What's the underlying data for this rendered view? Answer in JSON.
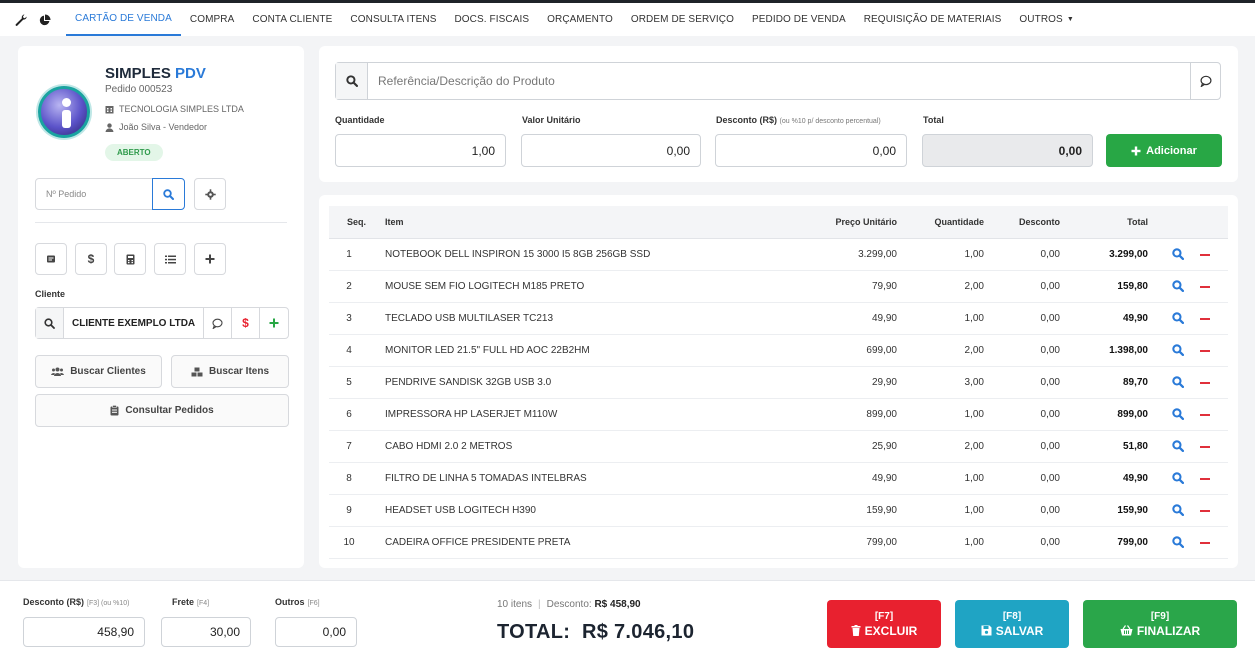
{
  "nav": {
    "items": [
      "CARTÃO DE VENDA",
      "COMPRA",
      "CONTA CLIENTE",
      "CONSULTA ITENS",
      "DOCS. FISCAIS",
      "ORÇAMENTO",
      "ORDEM DE SERVIÇO",
      "PEDIDO DE VENDA",
      "REQUISIÇÃO DE MATERIAIS",
      "OUTROS"
    ],
    "active_index": 0
  },
  "sidebar": {
    "brand_main": "SIMPLES",
    "brand_accent": "PDV",
    "pedido": "Pedido 000523",
    "company": "TECNOLOGIA SIMPLES LTDA",
    "vendor": "João Silva - Vendedor",
    "status": "ABERTO",
    "pedido_placeholder": "Nº Pedido",
    "cliente_label": "Cliente",
    "cliente_name": "CLIENTE EXEMPLO LTDA",
    "buscar_clientes": "Buscar Clientes",
    "buscar_itens": "Buscar Itens",
    "consultar_pedidos": "Consultar Pedidos"
  },
  "product_form": {
    "search_placeholder": "Referência/Descrição do Produto",
    "quantidade_label": "Quantidade",
    "quantidade": "1,00",
    "valor_label": "Valor Unitário",
    "valor": "0,00",
    "desconto_label": "Desconto (R$)",
    "desconto_hint": "(ou %10 p/ desconto percentual)",
    "desconto": "0,00",
    "total_label": "Total",
    "total": "0,00",
    "add_label": "Adicionar"
  },
  "table": {
    "headers": {
      "seq": "Seq.",
      "item": "Item",
      "preco": "Preço Unitário",
      "qtd": "Quantidade",
      "desc": "Desconto",
      "total": "Total"
    },
    "rows": [
      {
        "seq": "1",
        "item": "NOTEBOOK DELL INSPIRON 15 3000 I5 8GB 256GB SSD",
        "preco": "3.299,00",
        "qtd": "1,00",
        "desc": "0,00",
        "total": "3.299,00"
      },
      {
        "seq": "2",
        "item": "MOUSE SEM FIO LOGITECH M185 PRETO",
        "preco": "79,90",
        "qtd": "2,00",
        "desc": "0,00",
        "total": "159,80"
      },
      {
        "seq": "3",
        "item": "TECLADO USB MULTILASER TC213",
        "preco": "49,90",
        "qtd": "1,00",
        "desc": "0,00",
        "total": "49,90"
      },
      {
        "seq": "4",
        "item": "MONITOR LED 21.5\" FULL HD AOC 22B2HM",
        "preco": "699,00",
        "qtd": "2,00",
        "desc": "0,00",
        "total": "1.398,00"
      },
      {
        "seq": "5",
        "item": "PENDRIVE SANDISK 32GB USB 3.0",
        "preco": "29,90",
        "qtd": "3,00",
        "desc": "0,00",
        "total": "89,70"
      },
      {
        "seq": "6",
        "item": "IMPRESSORA HP LASERJET M110W",
        "preco": "899,00",
        "qtd": "1,00",
        "desc": "0,00",
        "total": "899,00"
      },
      {
        "seq": "7",
        "item": "CABO HDMI 2.0 2 METROS",
        "preco": "25,90",
        "qtd": "2,00",
        "desc": "0,00",
        "total": "51,80"
      },
      {
        "seq": "8",
        "item": "FILTRO DE LINHA 5 TOMADAS INTELBRAS",
        "preco": "49,90",
        "qtd": "1,00",
        "desc": "0,00",
        "total": "49,90"
      },
      {
        "seq": "9",
        "item": "HEADSET USB LOGITECH H390",
        "preco": "159,90",
        "qtd": "1,00",
        "desc": "0,00",
        "total": "159,90"
      },
      {
        "seq": "10",
        "item": "CADEIRA OFFICE PRESIDENTE PRETA",
        "preco": "799,00",
        "qtd": "1,00",
        "desc": "0,00",
        "total": "799,00"
      }
    ]
  },
  "footer": {
    "desconto_label": "Desconto (R$)",
    "desconto_hint": "[F3] (ou %10)",
    "desconto": "458,90",
    "frete_label": "Frete",
    "frete_hint": "[F4]",
    "frete": "30,00",
    "outros_label": "Outros",
    "outros_hint": "[F6]",
    "outros": "0,00",
    "itens": "10 itens",
    "desconto_summary_label": "Desconto:",
    "desconto_summary": "R$ 458,90",
    "total_label": "TOTAL:",
    "total": "R$ 7.046,10",
    "excluir_key": "[F7]",
    "excluir": "EXCLUIR",
    "salvar_key": "[F8]",
    "salvar": "SALVAR",
    "finalizar_key": "[F9]",
    "finalizar": "FINALIZAR"
  },
  "colors": {
    "accent": "#2a7ad8",
    "success": "#28a745",
    "danger": "#e8212f",
    "info": "#1fa4c4",
    "finalize": "#2aa64a"
  },
  "icons": [
    "wrench-icon",
    "pie-chart-icon",
    "search-icon",
    "chat-icon",
    "gear-icon",
    "note-icon",
    "dollar-icon",
    "calculator-icon",
    "list-icon",
    "plus-icon",
    "users-icon",
    "boxes-icon",
    "clipboard-icon",
    "trash-icon",
    "save-icon",
    "basket-icon",
    "remove-icon"
  ]
}
